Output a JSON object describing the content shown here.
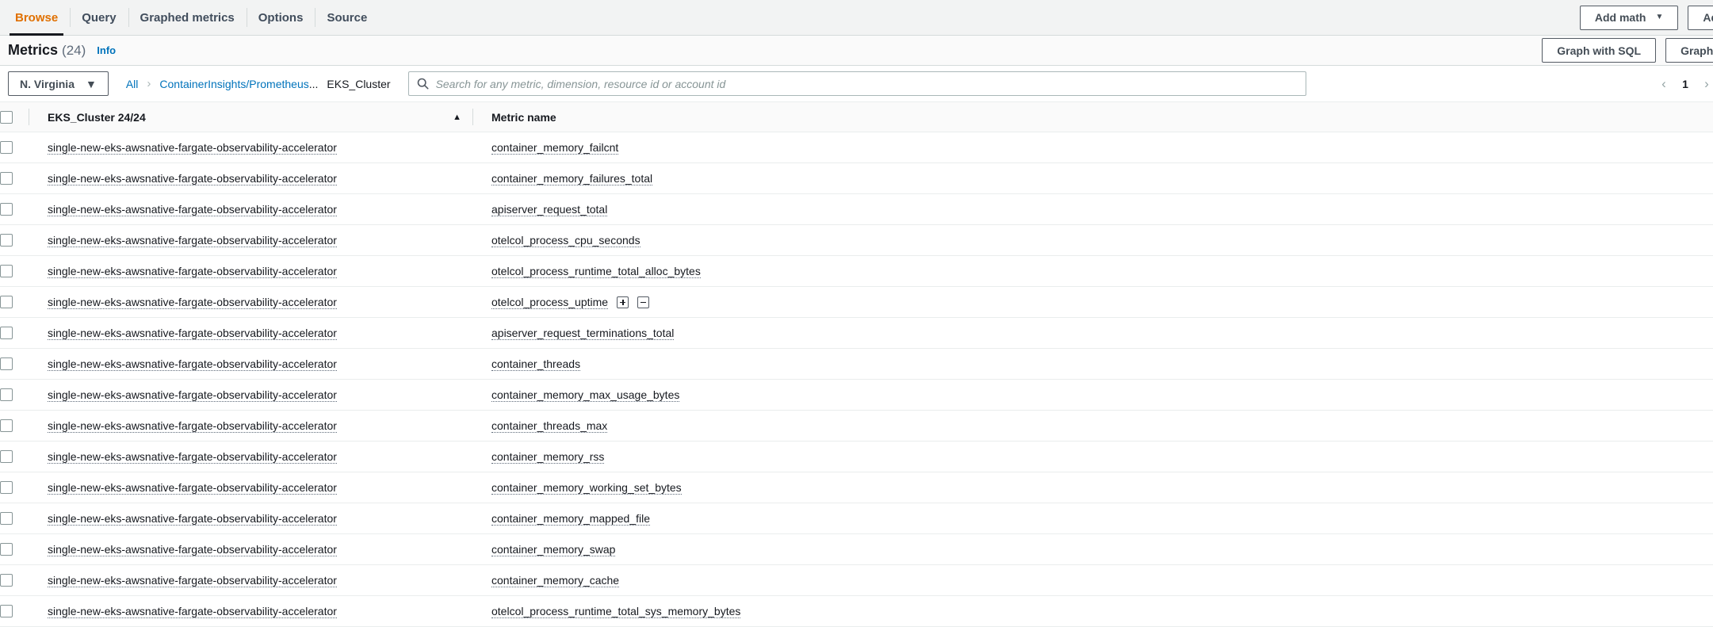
{
  "tabs": [
    {
      "label": "Browse",
      "active": true
    },
    {
      "label": "Query",
      "active": false
    },
    {
      "label": "Graphed metrics",
      "active": false
    },
    {
      "label": "Options",
      "active": false
    },
    {
      "label": "Source",
      "active": false
    }
  ],
  "tabbar_actions": {
    "add_math": "Add math",
    "add_math_caret": "▼",
    "add_query": "Add q"
  },
  "title": {
    "heading": "Metrics",
    "count": "(24)",
    "info": "Info"
  },
  "title_actions": {
    "graph_with_sql": "Graph with SQL",
    "graph_search": "Graph sear"
  },
  "toolbar": {
    "region": "N. Virginia",
    "region_caret": "▼",
    "breadcrumb": {
      "root": "All",
      "separator": "›",
      "namespace": "ContainerInsights/Prometheus",
      "namespace_truncation": "...",
      "current": "EKS_Cluster"
    },
    "search_placeholder": "Search for any metric, dimension, resource id or account id",
    "pagination": {
      "prev": "‹",
      "page": "1",
      "next": "›"
    }
  },
  "table": {
    "columns": {
      "cluster": "EKS_Cluster 24/24",
      "sort_indicator": "▲",
      "metric": "Metric name"
    },
    "rows": [
      {
        "cluster": "single-new-eks-awsnative-fargate-observability-accelerator",
        "metric": "container_memory_failcnt",
        "actions": false
      },
      {
        "cluster": "single-new-eks-awsnative-fargate-observability-accelerator",
        "metric": "container_memory_failures_total",
        "actions": false
      },
      {
        "cluster": "single-new-eks-awsnative-fargate-observability-accelerator",
        "metric": "apiserver_request_total",
        "actions": false
      },
      {
        "cluster": "single-new-eks-awsnative-fargate-observability-accelerator",
        "metric": "otelcol_process_cpu_seconds",
        "actions": false
      },
      {
        "cluster": "single-new-eks-awsnative-fargate-observability-accelerator",
        "metric": "otelcol_process_runtime_total_alloc_bytes",
        "actions": false
      },
      {
        "cluster": "single-new-eks-awsnative-fargate-observability-accelerator",
        "metric": "otelcol_process_uptime",
        "actions": true
      },
      {
        "cluster": "single-new-eks-awsnative-fargate-observability-accelerator",
        "metric": "apiserver_request_terminations_total",
        "actions": false
      },
      {
        "cluster": "single-new-eks-awsnative-fargate-observability-accelerator",
        "metric": "container_threads",
        "actions": false
      },
      {
        "cluster": "single-new-eks-awsnative-fargate-observability-accelerator",
        "metric": "container_memory_max_usage_bytes",
        "actions": false
      },
      {
        "cluster": "single-new-eks-awsnative-fargate-observability-accelerator",
        "metric": "container_threads_max",
        "actions": false
      },
      {
        "cluster": "single-new-eks-awsnative-fargate-observability-accelerator",
        "metric": "container_memory_rss",
        "actions": false
      },
      {
        "cluster": "single-new-eks-awsnative-fargate-observability-accelerator",
        "metric": "container_memory_working_set_bytes",
        "actions": false
      },
      {
        "cluster": "single-new-eks-awsnative-fargate-observability-accelerator",
        "metric": "container_memory_mapped_file",
        "actions": false
      },
      {
        "cluster": "single-new-eks-awsnative-fargate-observability-accelerator",
        "metric": "container_memory_swap",
        "actions": false
      },
      {
        "cluster": "single-new-eks-awsnative-fargate-observability-accelerator",
        "metric": "container_memory_cache",
        "actions": false
      },
      {
        "cluster": "single-new-eks-awsnative-fargate-observability-accelerator",
        "metric": "otelcol_process_runtime_total_sys_memory_bytes",
        "actions": false
      }
    ]
  },
  "colors": {
    "active_tab": "#e07000",
    "link": "#0073bb",
    "border": "#d5dbdb",
    "row_divider": "#eaeded",
    "header_bg": "#fafafa",
    "tabbar_bg": "#f2f3f3"
  }
}
